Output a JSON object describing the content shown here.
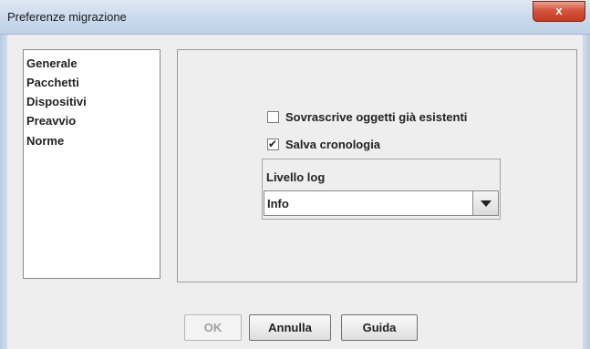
{
  "window": {
    "title": "Preferenze migrazione",
    "close_label": "x"
  },
  "sidebar": {
    "items": [
      {
        "label": "Generale"
      },
      {
        "label": "Pacchetti"
      },
      {
        "label": "Dispositivi"
      },
      {
        "label": "Preavvio"
      },
      {
        "label": "Norme"
      }
    ]
  },
  "options": {
    "overwrite": {
      "label": "Sovrascrive oggetti già esistenti",
      "checked": false
    },
    "save_history": {
      "label": "Salva cronologia",
      "checked": true,
      "mark": "✔"
    }
  },
  "log": {
    "group_label": "Livello log",
    "selected": "Info"
  },
  "buttons": {
    "ok": "OK",
    "cancel": "Annulla",
    "help": "Guida"
  }
}
